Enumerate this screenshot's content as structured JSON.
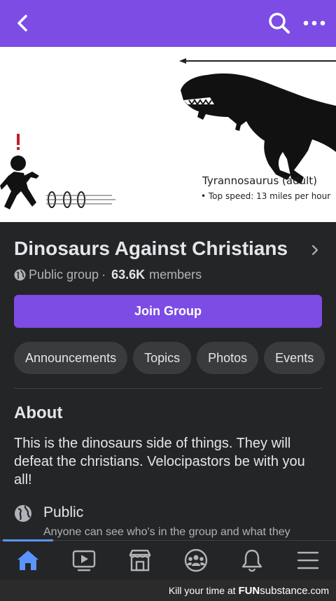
{
  "topbar": {
    "back_icon": "chevron-left-icon",
    "search_icon": "search-icon",
    "more_icon": "more-horizontal-icon"
  },
  "cover": {
    "caption_title": "Tyrannosaurus (adult)",
    "caption_detail": "• Top speed: 13 miles per hour",
    "exclamation": "!"
  },
  "group": {
    "title": "Dinosaurs Against Christians",
    "privacy": "Public group",
    "separator": "·",
    "member_count": "63.6K",
    "members_label": "members",
    "join_label": "Join Group"
  },
  "chips": [
    "Announcements",
    "Topics",
    "Photos",
    "Events"
  ],
  "about": {
    "title": "About",
    "description": "This is the dinosaurs side of things. They will defeat the christians. Velocipastors be with you all!",
    "public_title": "Public",
    "public_description": "Anyone can see who's in the group and what they"
  },
  "tabbar": {
    "items": [
      "home-icon",
      "watch-icon",
      "marketplace-icon",
      "groups-icon",
      "notifications-icon",
      "menu-icon"
    ],
    "active": "home-icon",
    "accent": "#5b93ff"
  },
  "footer": {
    "prefix": "Kill your time at",
    "brand_bold": "FUN",
    "brand_rest": "substance",
    "suffix": ".com"
  },
  "colors": {
    "brand": "#7c4ce4",
    "background": "#242526",
    "chip": "#3a3b3c"
  }
}
